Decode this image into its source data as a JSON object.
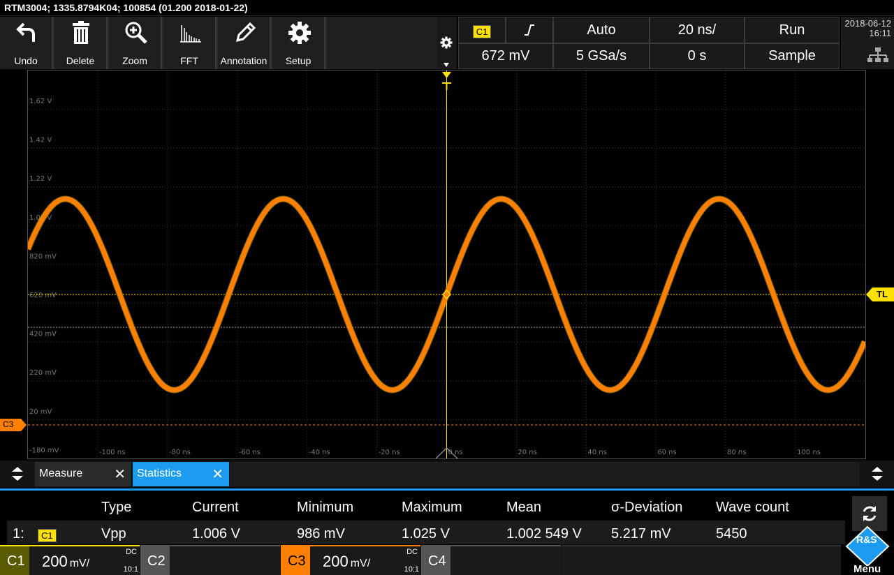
{
  "title": "RTM3004; 1335.8794K04; 100854 (01.200 2018-01-22)",
  "toolbar": [
    {
      "label": "Undo",
      "icon": "undo-icon"
    },
    {
      "label": "Delete",
      "icon": "trash-icon"
    },
    {
      "label": "Zoom",
      "icon": "zoom-icon"
    },
    {
      "label": "FFT",
      "icon": "fft-icon"
    },
    {
      "label": "Annotation",
      "icon": "pencil-icon"
    },
    {
      "label": "Setup",
      "icon": "gear-icon"
    }
  ],
  "trigger": {
    "channel": "C1",
    "mode": "Auto",
    "timebase": "20 ns/",
    "run": "Run",
    "level": "672 mV",
    "samplerate": "5 GSa/s",
    "position": "0 s",
    "acq": "Sample"
  },
  "datetime": {
    "date": "2018-06-12",
    "time": "16:11"
  },
  "grid": {
    "ylabels": [
      "1.62 V",
      "1.42 V",
      "1.22 V",
      "1.02 V",
      "820 mV",
      "620 mV",
      "420 mV",
      "220 mV",
      "20 mV",
      "-180 mV"
    ],
    "xlabels": [
      "-100 ns",
      "-80 ns",
      "-60 ns",
      "-40 ns",
      "-20 ns",
      "0 ns",
      "20 ns",
      "40 ns",
      "60 ns",
      "80 ns",
      "100 ns"
    ],
    "tl_label": "TL",
    "c3_label": "C3"
  },
  "measure": {
    "tabs": [
      "Measure",
      "Statistics"
    ],
    "headers": [
      "Type",
      "Current",
      "Minimum",
      "Maximum",
      "Mean",
      "σ-Deviation",
      "Wave count"
    ],
    "row": {
      "index": "1:",
      "channel": "C1",
      "type": "Vpp",
      "current": "1.006 V",
      "minimum": "986 mV",
      "maximum": "1.025 V",
      "mean": "1.002 549 V",
      "sdev": "5.217 mV",
      "count": "5450"
    }
  },
  "channels": [
    {
      "name": "C1",
      "scale": "200",
      "unit": "mV/",
      "coupling": "DC",
      "ratio": "10:1",
      "color": "#ffe100"
    },
    {
      "name": "C2",
      "color": "#777777"
    },
    {
      "name": "C3",
      "scale": "200",
      "unit": "mV/",
      "coupling": "DC",
      "ratio": "10:1",
      "color": "#ff8000"
    },
    {
      "name": "C4",
      "color": "#777777"
    }
  ],
  "menu_label": "Menu",
  "logo_text": "R&S",
  "colors": {
    "trace": "#ff8000",
    "trigger": "#ffe100",
    "accent": "#1d9bf0"
  }
}
